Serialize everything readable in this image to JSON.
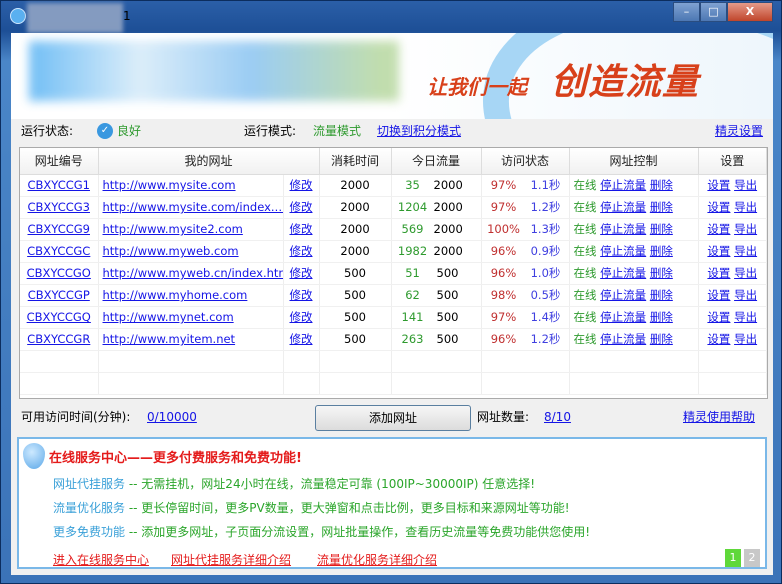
{
  "window": {
    "title_suffix": "1",
    "minimize": "–",
    "maximize": "□",
    "close": "X"
  },
  "banner": {
    "slogan_part1": "让我们一起",
    "slogan_part2": "创造流量"
  },
  "status": {
    "run_state_label": "运行状态:",
    "run_state_value": "良好",
    "run_mode_label": "运行模式:",
    "run_mode_value": "流量模式",
    "switch_link": "切换到积分模式",
    "settings_link": "精灵设置"
  },
  "table": {
    "headers": [
      "网址编号",
      "我的网址",
      "消耗时间",
      "今日流量",
      "访问状态",
      "网址控制",
      "设置"
    ],
    "edit_label": "修改",
    "online_label": "在线",
    "stop_label": "停止流量",
    "delete_label": "删除",
    "setting_label": "设置",
    "export_label": "导出",
    "rows": [
      {
        "id": "CBXYCCG1",
        "url": "http://www.mysite.com",
        "time": "2000",
        "today": "35",
        "limit": "2000",
        "rate": "97%",
        "speed": "1.1秒"
      },
      {
        "id": "CBXYCCG3",
        "url": "http://www.mysite.com/index.…",
        "time": "2000",
        "today": "1204",
        "limit": "2000",
        "rate": "97%",
        "speed": "1.2秒"
      },
      {
        "id": "CBXYCCG9",
        "url": "http://www.mysite2.com",
        "time": "2000",
        "today": "569",
        "limit": "2000",
        "rate": "100%",
        "speed": "1.3秒"
      },
      {
        "id": "CBXYCCGC",
        "url": "http://www.myweb.com",
        "time": "2000",
        "today": "1982",
        "limit": "2000",
        "rate": "96%",
        "speed": "0.9秒"
      },
      {
        "id": "CBXYCCGO",
        "url": "http://www.myweb.cn/index.htm",
        "time": "500",
        "today": "51",
        "limit": "500",
        "rate": "96%",
        "speed": "1.0秒"
      },
      {
        "id": "CBXYCCGP",
        "url": "http://www.myhome.com",
        "time": "500",
        "today": "62",
        "limit": "500",
        "rate": "98%",
        "speed": "0.5秒"
      },
      {
        "id": "CBXYCCGQ",
        "url": "http://www.mynet.com",
        "time": "500",
        "today": "141",
        "limit": "500",
        "rate": "97%",
        "speed": "1.4秒"
      },
      {
        "id": "CBXYCCGR",
        "url": "http://www.myitem.net",
        "time": "500",
        "today": "263",
        "limit": "500",
        "rate": "96%",
        "speed": "1.2秒"
      }
    ]
  },
  "bottom": {
    "time_label": "可用访问时间(分钟):",
    "time_value": "0/10000",
    "add_button": "添加网址",
    "count_label": "网址数量:",
    "count_value": "8/10",
    "help_link": "精灵使用帮助"
  },
  "service": {
    "title": "在线服务中心——更多付费服务和免费功能!",
    "lines": [
      {
        "name": "网址代挂服务",
        "desc": " -- 无需挂机，网址24小时在线，流量稳定可靠 (100IP~30000IP) 任意选择!"
      },
      {
        "name": "流量优化服务",
        "desc": " -- 更长停留时间，更多PV数量，更大弹窗和点击比例，更多目标和来源网址等功能!"
      },
      {
        "name": "更多免费功能",
        "desc": " -- 添加更多网址，子页面分流设置，网址批量操作，查看历史流量等免费功能供您使用!"
      }
    ],
    "links": [
      "进入在线服务中心",
      "网址代挂服务详细介绍",
      "流量优化服务详细介绍"
    ],
    "pages": [
      "1",
      "2"
    ],
    "active_page": "1"
  },
  "colors": {
    "link": "#1515e6",
    "green": "#2e9a2e",
    "rate_red": "#c03030",
    "speed_blue": "#4040e0",
    "service_red": "#e41b1b"
  }
}
